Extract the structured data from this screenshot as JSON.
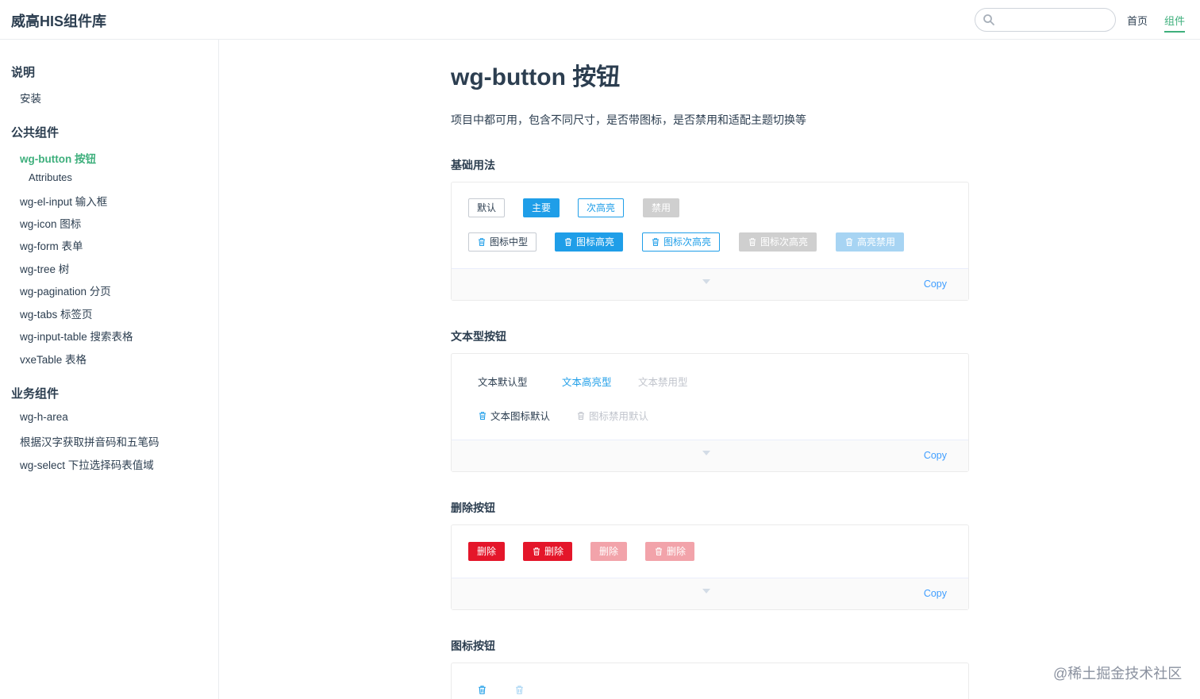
{
  "navbar": {
    "title": "威高HIS组件库",
    "search": {
      "value": "",
      "placeholder": ""
    },
    "links": [
      "首页",
      "组件"
    ]
  },
  "sidebar": {
    "groups": [
      {
        "title": "说明",
        "items": [
          "安装"
        ]
      },
      {
        "title": "公共组件",
        "items": [
          "wg-button 按钮",
          "Attributes",
          "wg-el-input 输入框",
          "wg-icon 图标",
          "wg-form 表单",
          "wg-tree 树",
          "wg-pagination 分页",
          "wg-tabs 标签页",
          "wg-input-table 搜索表格",
          "vxeTable 表格"
        ]
      },
      {
        "title": "业务组件",
        "items": [
          "wg-h-area",
          "根据汉字获取拼音码和五笔码",
          "wg-select 下拉选择码表值域"
        ]
      }
    ]
  },
  "main": {
    "title": "wg-button 按钮",
    "description": "项目中都可用，包含不同尺寸，是否带图标，是否禁用和适配主题切换等",
    "copy_label": "Copy",
    "sections": [
      {
        "title": "基础用法",
        "row1": [
          "默认",
          "主要",
          "次高亮",
          "禁用"
        ],
        "row2": [
          "图标中型",
          "图标高亮",
          "图标次高亮",
          "图标次高亮",
          "高亮禁用"
        ]
      },
      {
        "title": "文本型按钮",
        "row1": [
          "文本默认型",
          "文本高亮型",
          "文本禁用型"
        ],
        "row2": [
          "文本图标默认",
          "图标禁用默认"
        ]
      },
      {
        "title": "删除按钮",
        "row1": [
          "删除",
          "删除",
          "删除",
          "删除"
        ]
      },
      {
        "title": "图标按钮"
      }
    ]
  },
  "colors": {
    "brand_green": "#3eaf7c",
    "primary_blue": "#1f9ee8",
    "danger_red": "#e4162a",
    "copy_blue": "#409eff"
  },
  "watermark": "@稀土掘金技术社区"
}
